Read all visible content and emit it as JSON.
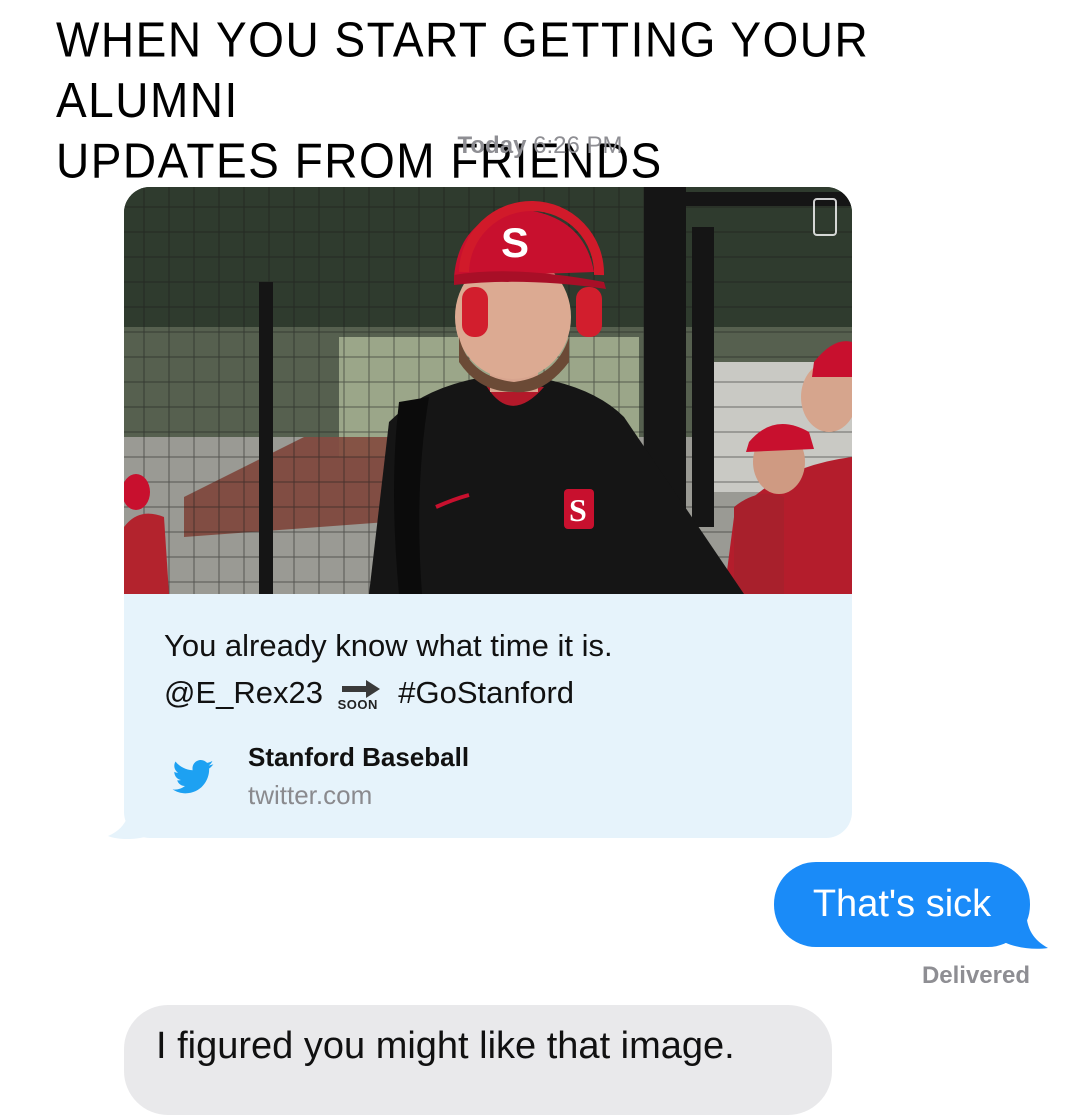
{
  "headline": {
    "line1": "WHEN YOU START GETTING YOUR ALUMNI",
    "line2": "UPDATES FROM FRIENDS"
  },
  "thread": {
    "timestamp_day": "Today",
    "timestamp_time": "6:26 PM",
    "link_preview": {
      "image_alt": "Stanford baseball player in red cap and headphones",
      "tweet_line1": "You already know what time it is.",
      "tweet_handle": "@E_Rex23",
      "soon_label": "SOON",
      "tweet_hashtag": "#GoStanford",
      "source_name": "Stanford Baseball",
      "source_domain": "twitter.com",
      "source_icon": "twitter-bird-icon"
    },
    "sent_message": "That's sick",
    "delivery_status": "Delivered",
    "received_message": "I figured you might like that image."
  },
  "colors": {
    "sent_bubble": "#1a8bf8",
    "received_bubble": "#e9e9eb",
    "link_preview_bg": "#e6f3fb",
    "twitter_blue": "#1da1f2",
    "stanford_red": "#c8102e"
  }
}
